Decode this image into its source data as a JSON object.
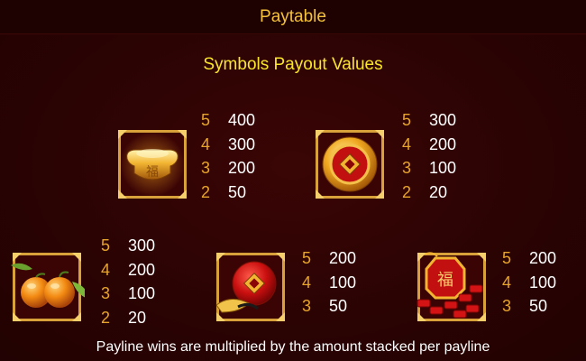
{
  "header": {
    "title": "Paytable"
  },
  "section": {
    "title": "Symbols Payout Values"
  },
  "symbols": [
    {
      "icon": "gold-ingot-icon",
      "payouts": [
        {
          "count": "5",
          "value": "400"
        },
        {
          "count": "4",
          "value": "300"
        },
        {
          "count": "3",
          "value": "200"
        },
        {
          "count": "2",
          "value": "50"
        }
      ]
    },
    {
      "icon": "gold-coin-icon",
      "payouts": [
        {
          "count": "5",
          "value": "300"
        },
        {
          "count": "4",
          "value": "200"
        },
        {
          "count": "3",
          "value": "100"
        },
        {
          "count": "2",
          "value": "20"
        }
      ]
    },
    {
      "icon": "oranges-icon",
      "payouts": [
        {
          "count": "5",
          "value": "300"
        },
        {
          "count": "4",
          "value": "200"
        },
        {
          "count": "3",
          "value": "100"
        },
        {
          "count": "2",
          "value": "20"
        }
      ]
    },
    {
      "icon": "red-envelope-pouch-icon",
      "payouts": [
        {
          "count": "5",
          "value": "200"
        },
        {
          "count": "4",
          "value": "100"
        },
        {
          "count": "3",
          "value": "50"
        }
      ]
    },
    {
      "icon": "firecrackers-icon",
      "payouts": [
        {
          "count": "5",
          "value": "200"
        },
        {
          "count": "4",
          "value": "100"
        },
        {
          "count": "3",
          "value": "50"
        }
      ]
    }
  ],
  "footer": {
    "note": "Payline wins are multiplied by the amount stacked per payline"
  },
  "colors": {
    "background": "#2a0303",
    "header_background": "#1e0202",
    "title": "#f5c13a",
    "subtitle": "#f9e52a",
    "count": "#e8a52b",
    "value": "#ffffff",
    "frame_gold": "#d9a13a"
  }
}
